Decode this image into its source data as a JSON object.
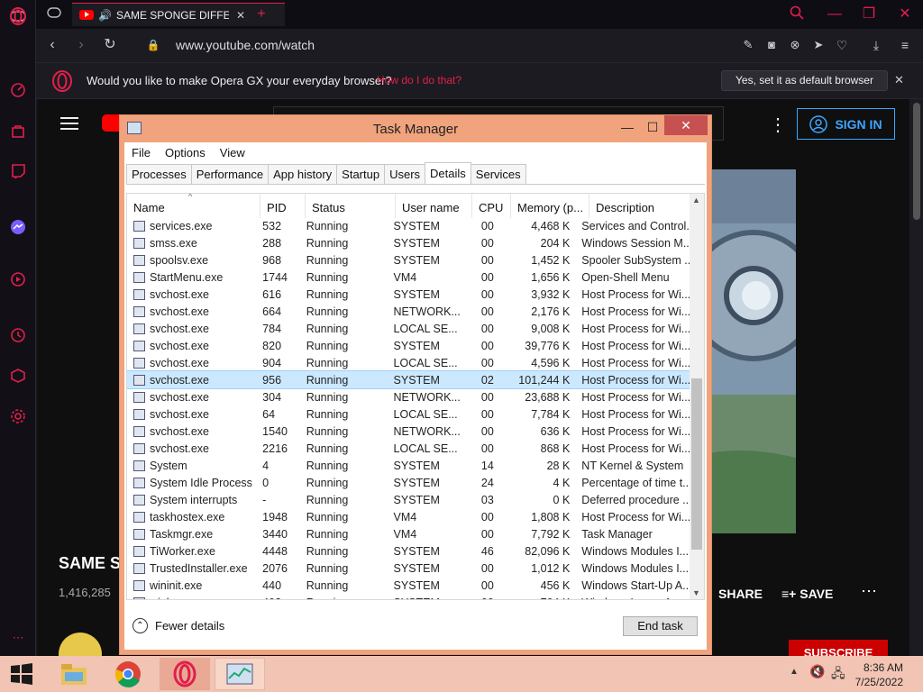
{
  "browser": {
    "tab_title": "SAME SPONGE DIFFERE",
    "url": "www.youtube.com/watch",
    "banner": {
      "message": "Would you like to make Opera GX your everyday browser?",
      "link": "How do I do that?",
      "button": "Yes, set it as default browser"
    },
    "accent": "#e0204a"
  },
  "youtube": {
    "sign_in": "SIGN IN",
    "title": "SAME S",
    "views": "1,416,285",
    "share": "SHARE",
    "save": "SAVE",
    "subscribe": "SUBSCRIBE"
  },
  "task_manager": {
    "title": "Task Manager",
    "menu": [
      "File",
      "Options",
      "View"
    ],
    "tabs": [
      "Processes",
      "Performance",
      "App history",
      "Startup",
      "Users",
      "Details",
      "Services"
    ],
    "active_tab": "Details",
    "columns": [
      "Name",
      "PID",
      "Status",
      "User name",
      "CPU",
      "Memory (p...",
      "Description"
    ],
    "rows": [
      [
        "services.exe",
        "532",
        "Running",
        "SYSTEM",
        "00",
        "4,468 K",
        "Services and Control..."
      ],
      [
        "smss.exe",
        "288",
        "Running",
        "SYSTEM",
        "00",
        "204 K",
        "Windows Session M..."
      ],
      [
        "spoolsv.exe",
        "968",
        "Running",
        "SYSTEM",
        "00",
        "1,452 K",
        "Spooler SubSystem ..."
      ],
      [
        "StartMenu.exe",
        "1744",
        "Running",
        "VM4",
        "00",
        "1,656 K",
        "Open-Shell Menu"
      ],
      [
        "svchost.exe",
        "616",
        "Running",
        "SYSTEM",
        "00",
        "3,932 K",
        "Host Process for Wi..."
      ],
      [
        "svchost.exe",
        "664",
        "Running",
        "NETWORK...",
        "00",
        "2,176 K",
        "Host Process for Wi..."
      ],
      [
        "svchost.exe",
        "784",
        "Running",
        "LOCAL SE...",
        "00",
        "9,008 K",
        "Host Process for Wi..."
      ],
      [
        "svchost.exe",
        "820",
        "Running",
        "SYSTEM",
        "00",
        "39,776 K",
        "Host Process for Wi..."
      ],
      [
        "svchost.exe",
        "904",
        "Running",
        "LOCAL SE...",
        "00",
        "4,596 K",
        "Host Process for Wi..."
      ],
      [
        "svchost.exe",
        "956",
        "Running",
        "SYSTEM",
        "02",
        "101,244 K",
        "Host Process for Wi..."
      ],
      [
        "svchost.exe",
        "304",
        "Running",
        "NETWORK...",
        "00",
        "23,688 K",
        "Host Process for Wi..."
      ],
      [
        "svchost.exe",
        "64",
        "Running",
        "LOCAL SE...",
        "00",
        "7,784 K",
        "Host Process for Wi..."
      ],
      [
        "svchost.exe",
        "1540",
        "Running",
        "NETWORK...",
        "00",
        "636 K",
        "Host Process for Wi..."
      ],
      [
        "svchost.exe",
        "2216",
        "Running",
        "LOCAL SE...",
        "00",
        "868 K",
        "Host Process for Wi..."
      ],
      [
        "System",
        "4",
        "Running",
        "SYSTEM",
        "14",
        "28 K",
        "NT Kernel & System"
      ],
      [
        "System Idle Process",
        "0",
        "Running",
        "SYSTEM",
        "24",
        "4 K",
        "Percentage of time t..."
      ],
      [
        "System interrupts",
        "-",
        "Running",
        "SYSTEM",
        "03",
        "0 K",
        "Deferred procedure ..."
      ],
      [
        "taskhostex.exe",
        "1948",
        "Running",
        "VM4",
        "00",
        "1,808 K",
        "Host Process for Wi..."
      ],
      [
        "Taskmgr.exe",
        "3440",
        "Running",
        "VM4",
        "00",
        "7,792 K",
        "Task Manager"
      ],
      [
        "TiWorker.exe",
        "4448",
        "Running",
        "SYSTEM",
        "46",
        "82,096 K",
        "Windows Modules I..."
      ],
      [
        "TrustedInstaller.exe",
        "2076",
        "Running",
        "SYSTEM",
        "00",
        "1,012 K",
        "Windows Modules I..."
      ],
      [
        "wininit.exe",
        "440",
        "Running",
        "SYSTEM",
        "00",
        "456 K",
        "Windows Start-Up A..."
      ],
      [
        "winlogon.exe",
        "492",
        "Running",
        "SYSTEM",
        "00",
        "704 K",
        "Windows Logon Ap..."
      ]
    ],
    "selected_row": 9,
    "fewer_details": "Fewer details",
    "end_task": "End task"
  },
  "taskbar": {
    "time": "8:36 AM",
    "date": "7/25/2022"
  }
}
